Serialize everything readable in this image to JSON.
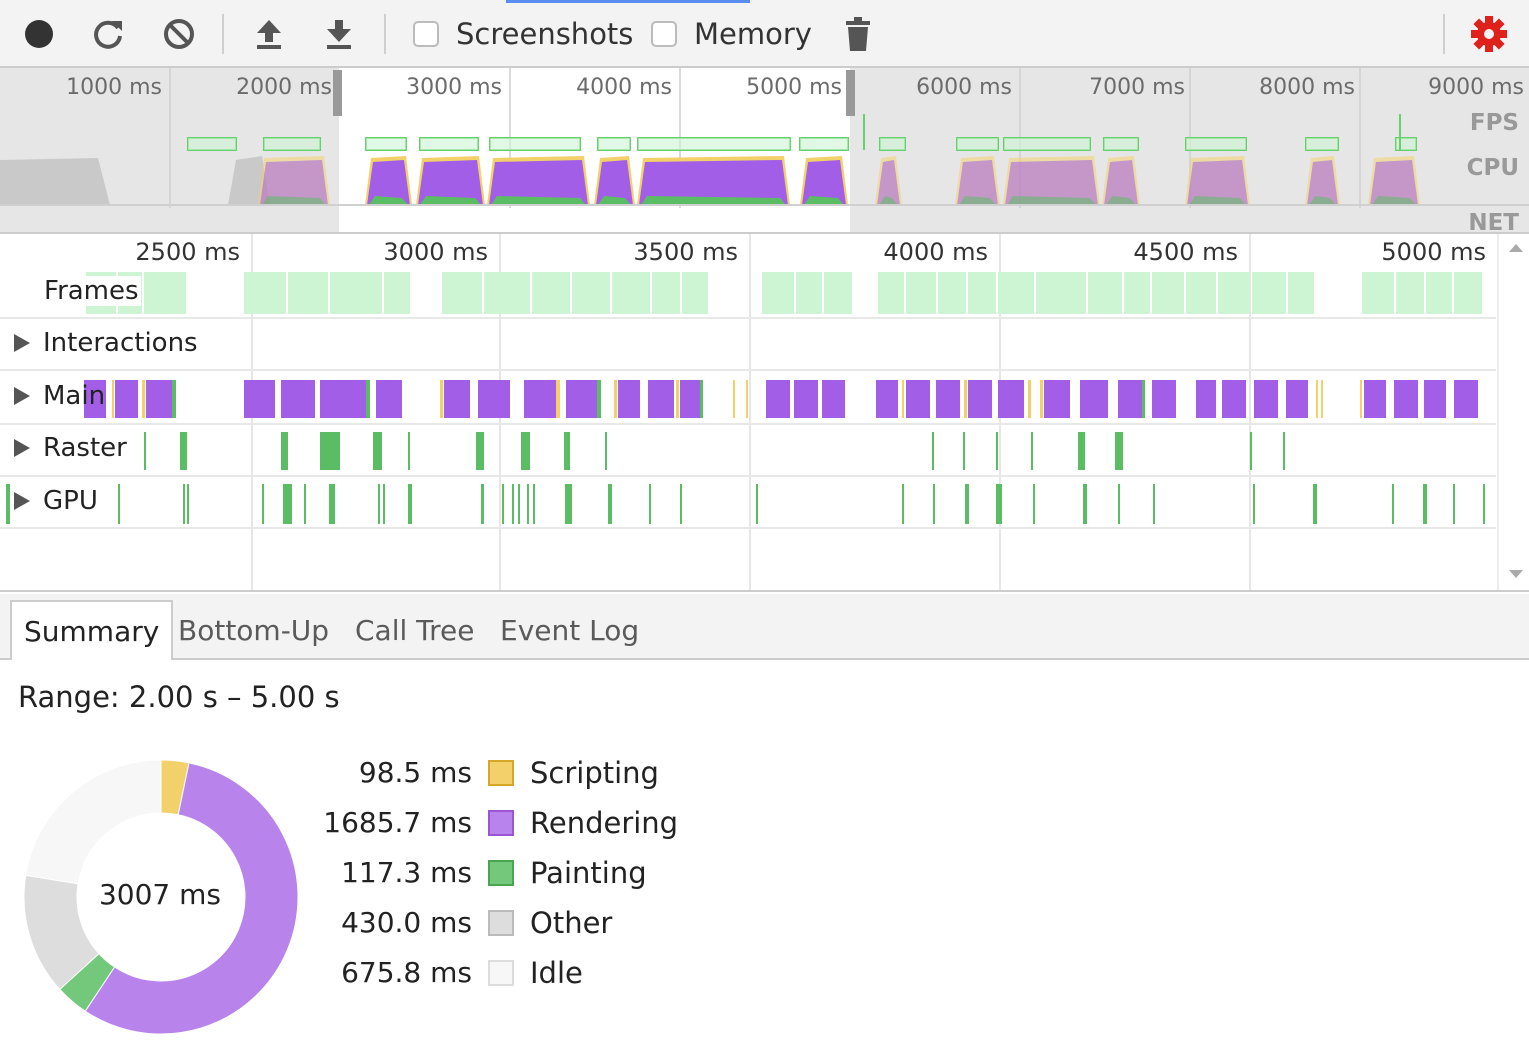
{
  "toolbar": {
    "record_icon": "record-icon",
    "reload_icon": "reload-icon",
    "clear_icon": "clear-icon",
    "upload_icon": "upload-icon",
    "download_icon": "download-icon",
    "screenshots_label": "Screenshots",
    "screenshots_checked": false,
    "memory_label": "Memory",
    "memory_checked": false,
    "trash_icon": "trash-icon",
    "settings_icon": "gear-icon",
    "settings_color": "#e0201b"
  },
  "overview": {
    "ticks": [
      "1000 ms",
      "2000 ms",
      "3000 ms",
      "4000 ms",
      "5000 ms",
      "6000 ms",
      "7000 ms",
      "8000 ms",
      "9000 ms"
    ],
    "lanes": [
      "FPS",
      "CPU",
      "NET"
    ]
  },
  "flamechart": {
    "ticks": [
      "2500 ms",
      "3000 ms",
      "3500 ms",
      "4000 ms",
      "4500 ms",
      "5000 ms"
    ],
    "tracks": [
      {
        "label": "Frames",
        "expandable": false
      },
      {
        "label": "Interactions",
        "expandable": true
      },
      {
        "label": "Main",
        "expandable": true
      },
      {
        "label": "Raster",
        "expandable": true
      },
      {
        "label": "GPU",
        "expandable": true
      }
    ]
  },
  "tabs": [
    "Summary",
    "Bottom-Up",
    "Call Tree",
    "Event Log"
  ],
  "active_tab": "Summary",
  "summary": {
    "range_label": "Range: 2.00 s – 5.00 s",
    "total_label": "3007 ms",
    "categories": [
      {
        "value": "98.5 ms",
        "ms": 98.5,
        "name": "Scripting",
        "fill": "#f2d16b",
        "border": "#d6a629"
      },
      {
        "value": "1685.7 ms",
        "ms": 1685.7,
        "name": "Rendering",
        "fill": "#b983ec",
        "border": "#9b55d4"
      },
      {
        "value": "117.3 ms",
        "ms": 117.3,
        "name": "Painting",
        "fill": "#74c87b",
        "border": "#4aa552"
      },
      {
        "value": "430.0 ms",
        "ms": 430.0,
        "name": "Other",
        "fill": "#dddddd",
        "border": "#bbbbbb"
      },
      {
        "value": "675.8 ms",
        "ms": 675.8,
        "name": "Idle",
        "fill": "#f7f7f7",
        "border": "#dddddd"
      }
    ]
  },
  "colors": {
    "scripting": "#f2d16b",
    "rendering": "#a35ee8",
    "painting": "#5bbd63",
    "frames": "#cdf4d3",
    "fps": "#66d06d"
  }
}
